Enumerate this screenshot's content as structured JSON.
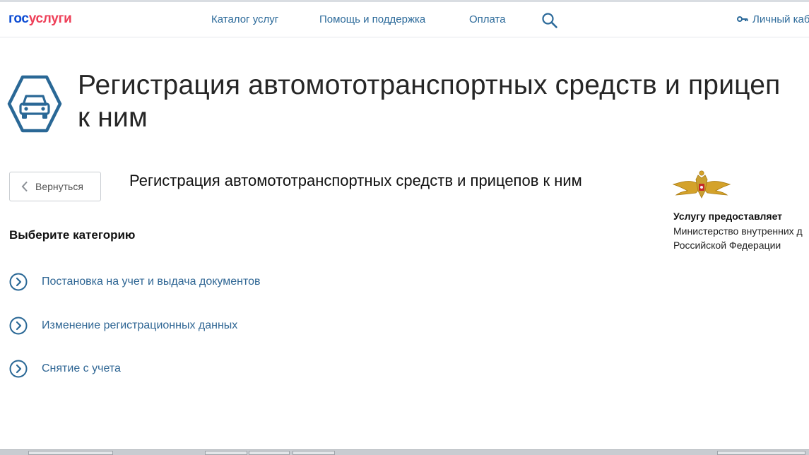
{
  "header": {
    "logo_part1": "гос",
    "logo_part2": "услуги",
    "nav": {
      "catalog": "Каталог услуг",
      "help": "Помощь и поддержка",
      "payment": "Оплата"
    },
    "account": "Личный каб"
  },
  "hero": {
    "title_line1": "Регистрация автомототранспортных средств и прицеп",
    "title_line2": "к ним"
  },
  "back_label": "Вернуться",
  "service_title": "Регистрация автомототранспортных средств и прицепов к ним",
  "provider": {
    "label": "Услугу предоставляет",
    "name_line1": "Министерство внутренних д",
    "name_line2": "Российской Федерации"
  },
  "section_title": "Выберите категорию",
  "categories": [
    {
      "label": "Постановка на учет и выдача документов"
    },
    {
      "label": "Изменение регистрационных данных"
    },
    {
      "label": "Снятие с учета"
    }
  ],
  "colors": {
    "brand_blue": "#0d4cd3",
    "brand_red": "#ee3f58",
    "link": "#2c6a9a",
    "icon_blue": "#2a6896"
  }
}
